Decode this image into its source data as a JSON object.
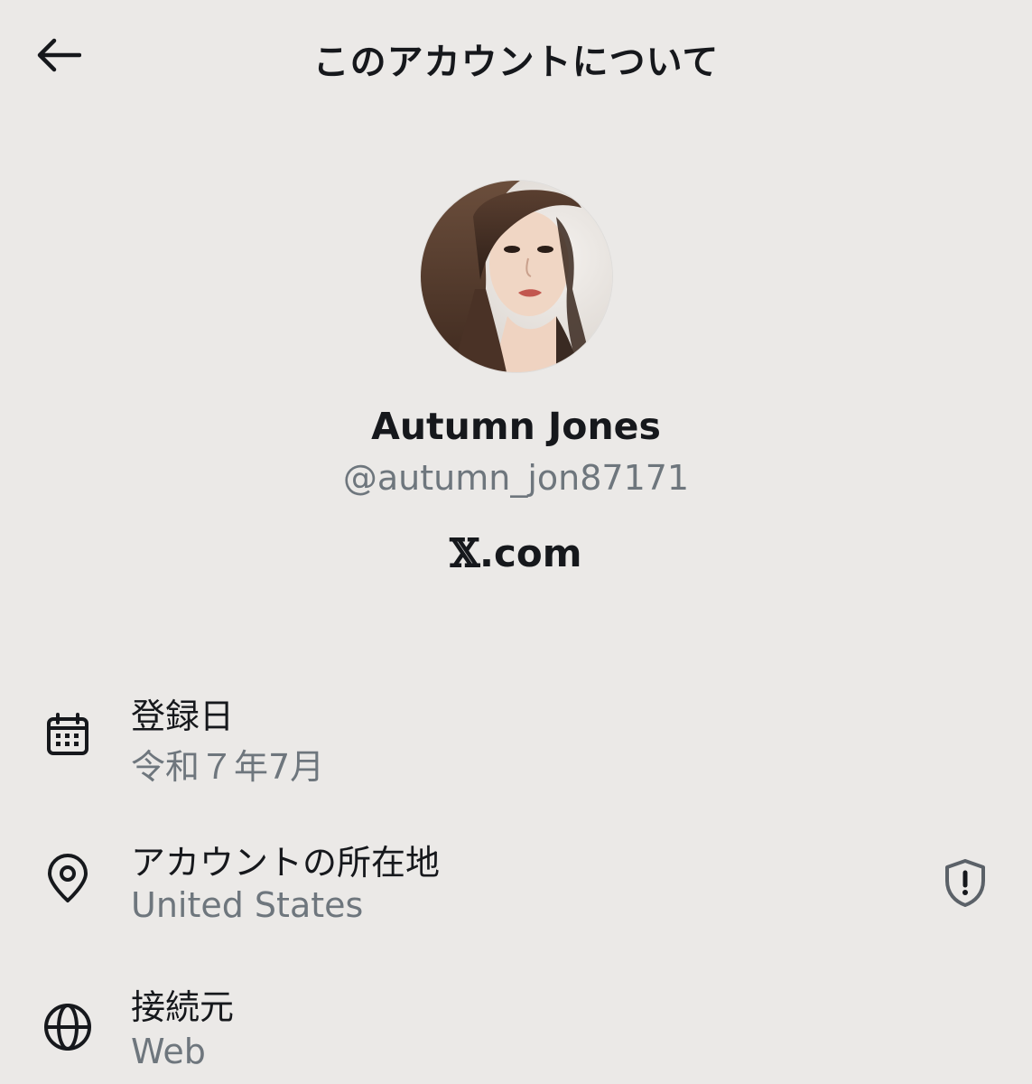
{
  "header": {
    "title": "このアカウントについて"
  },
  "profile": {
    "display_name": "Autumn Jones",
    "handle": "@autumn_jon87171",
    "site_logo": "𝕏",
    "site_suffix": ".com"
  },
  "info": [
    {
      "label": "登録日",
      "value": "令和７年7月",
      "icon": "calendar-icon"
    },
    {
      "label": "アカウントの所在地",
      "value": "United States",
      "icon": "location-pin-icon",
      "trailing_icon": "shield-alert-icon"
    },
    {
      "label": "接続元",
      "value": "Web",
      "icon": "globe-icon"
    }
  ],
  "colors": {
    "background": "#ebe9e7",
    "text_primary": "#16181c",
    "text_secondary": "#6e767d"
  }
}
